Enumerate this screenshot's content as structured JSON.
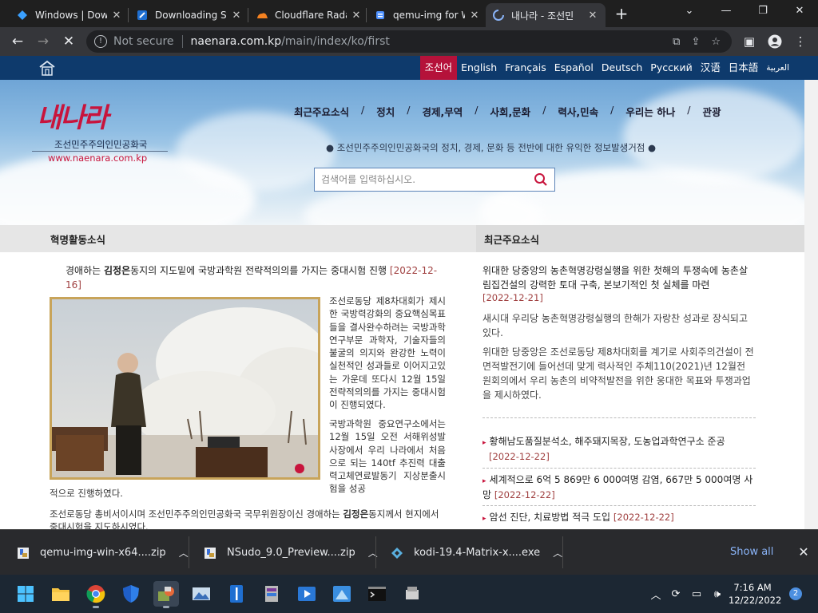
{
  "browser": {
    "tabs": [
      {
        "title": "Windows | Dow",
        "icon": "azure-icon"
      },
      {
        "title": "Downloading St",
        "icon": "site-icon"
      },
      {
        "title": "Cloudflare Rada",
        "icon": "cloudflare-icon"
      },
      {
        "title": "qemu-img for W",
        "icon": "doc-icon"
      },
      {
        "title": "내나라 - 조선민",
        "icon": "loading-icon",
        "active": true
      }
    ],
    "address": {
      "security_label": "Not secure",
      "host": "naenara.com.kp",
      "path": "/main/index/ko/first"
    }
  },
  "site": {
    "languages": [
      "조선어",
      "English",
      "Français",
      "Español",
      "Deutsch",
      "Русский",
      "汉语",
      "日本語",
      "العربية"
    ],
    "active_language": "조선어",
    "logo_text": "내나라",
    "logo_sub": "조선민주주의인민공화국",
    "logo_url": "www.naenara.com.kp",
    "nav": [
      "최근주요소식",
      "정치",
      "경제,무역",
      "사회,문화",
      "력사,민속",
      "우리는 하나",
      "관광"
    ],
    "tagline": "● 조선민주주의인민공화국의 정치, 경제, 문화 등 전반에 대한 유익한 정보발생거점 ●",
    "search_placeholder": "검색어를 입력하십시오.",
    "left_section": "혁명활동소식",
    "right_section": "최근주요소식"
  },
  "lead_article": {
    "pre": "경애하는 ",
    "name": "김정은",
    "post": "동지의 지도밑에 국방과학원 전략적의의를 가지는 중대시험 진행 ",
    "date": "[2022-12-16]",
    "body1": "조선로동당 제8차대회가 제시한 국방력강화의 중요핵심목표들을 결사완수하려는 국방과학연구부문 과학자, 기술자들의 불굴의 의지와 완강한 노력이 실천적인 성과들로 이어지고있는 가운데 또다시 12월 15일 전략적의의를 가지는 중대시험이 진행되였다.",
    "body2": "국방과학원 중요연구소에서는 12월 15일 오전 서해위성발사장에서 우리 나라에서 처음으로 되는 140tf 추진력 대출력고체연료발동기 지상분출시험을 성공",
    "tail": "적으로 진행하였다.",
    "p3_pre": "조선로동당 총비서이시며 조선민주주의인민공화국 국무위원장이신 경애하는 ",
    "p3_name": "김정은",
    "p3_post": "동지께서 현지에서 중대시험을 지도하시였다."
  },
  "right_news": {
    "headline": "위대한 당중앙의 농촌혁명강령실행을 위한 첫해의 투쟁속에 농촌살림집건설의 강력한 토대 구축, 본보기적인 첫 실체를 마련",
    "headline_date": "[2022-12-21]",
    "summary1": "새시대 우리당 농촌혁명강령실행의 한해가 자랑찬 성과로 장식되고있다.",
    "summary2": "위대한 당중앙은 조선로동당 제8차대회를 계기로 사회주의건설이 전면적발전기에 들어선데 맞게 력사적인 주체110(2021)년 12월전원회의에서 우리 농촌의 비약적발전을 위한 웅대한 목표와 투쟁과업을 제시하였다.",
    "items": [
      {
        "text": "황해남도품질분석소, 해주돼지목장, 도농업과학연구소 준공",
        "date": "[2022-12-22]"
      },
      {
        "text": "세계적으로 6억 5 869만 6 000여명 감염, 667만 5 000여명 사망",
        "date": "[2022-12-22]"
      },
      {
        "text": "암선 진단, 치료방법 적극 도입",
        "date": "[2022-12-22]"
      }
    ]
  },
  "downloads": [
    {
      "name": "qemu-img-win-x64....zip"
    },
    {
      "name": "NSudo_9.0_Preview....zip"
    },
    {
      "name": "kodi-19.4-Matrix-x....exe"
    }
  ],
  "shelf_show_all": "Show all",
  "taskbar": {
    "time": "7:16 AM",
    "date": "12/22/2022",
    "notifications": "2"
  }
}
